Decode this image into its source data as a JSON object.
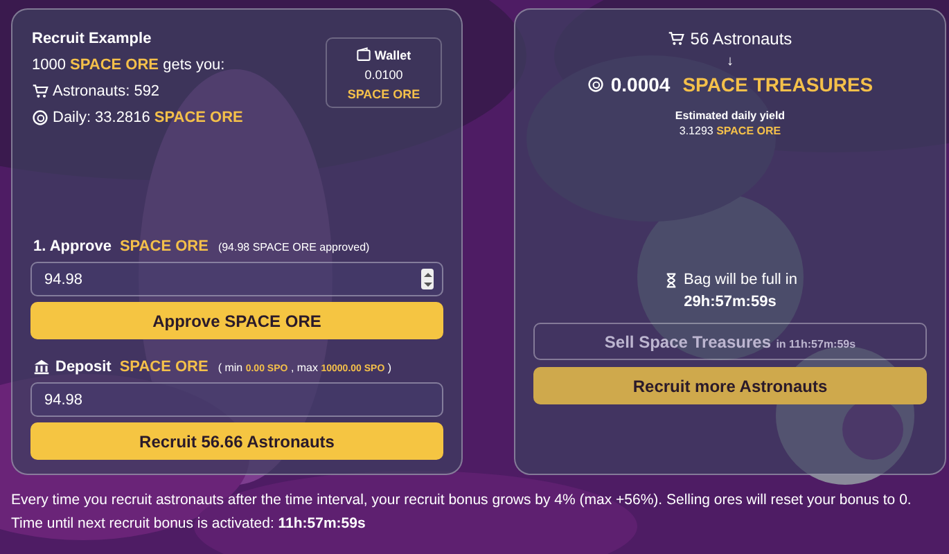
{
  "recruit_example": {
    "title": "Recruit Example",
    "lines": [
      {
        "kind": "amount",
        "segments": [
          {
            "kind": "plain",
            "text": "1000"
          },
          {
            "kind": "token",
            "text": "SPACE ORE"
          },
          {
            "kind": "plain",
            "text": "gets you:"
          }
        ]
      },
      {
        "kind": "astronauts",
        "segments": [
          {
            "kind": "plain",
            "text": "Astronauts: 592"
          }
        ]
      },
      {
        "kind": "daily",
        "segments": [
          {
            "kind": "plain",
            "text": "Daily: 33.2816"
          },
          {
            "kind": "token",
            "text": "SPACE ORE"
          }
        ]
      }
    ]
  },
  "wallet": {
    "title": "Wallet",
    "value": "0.0100",
    "unit": "SPACE ORE"
  },
  "approve": {
    "label": "1. Approve",
    "token": "SPACE ORE",
    "note": "(94.98 SPACE ORE approved)",
    "field": {
      "kind": "stepper",
      "value": "94.98"
    },
    "button": "Approve SPACE ORE"
  },
  "deposit": {
    "label": "Deposit",
    "token": "SPACE ORE",
    "limits": [
      {
        "kind": "plain",
        "text": "( min"
      },
      {
        "kind": "token",
        "text": "0.00 SPO"
      },
      {
        "kind": "plain",
        "text": ", max"
      },
      {
        "kind": "token",
        "text": "10000.00 SPO"
      },
      {
        "kind": "plain",
        "text": ")"
      }
    ],
    "field": {
      "kind": "plain",
      "value": "94.98"
    },
    "button": "Recruit 56.66 Astronauts"
  },
  "summary": {
    "astronauts": "56 Astronauts",
    "arrow": "↓",
    "amount": "0.0004",
    "token": "SPACE TREASURES",
    "yield_label": "Estimated daily yield",
    "yield_value": "3.1293",
    "yield_token": "SPACE ORE"
  },
  "bag": {
    "label": "Bag will be full in",
    "time": "29h:57m:59s"
  },
  "sell_button": {
    "label": "Sell Space Treasures",
    "suffix": "in 11h:57m:59s",
    "disabled": true
  },
  "recruit_more_button": {
    "label": "Recruit more Astronauts",
    "disabled": false
  },
  "footer": "Every time you recruit astronauts after the time interval, your recruit bonus grows by 4% (max +56%). Selling ores will reset your bonus to 0. Time until next recruit bonus is activated: **11h:57m:59s**"
}
